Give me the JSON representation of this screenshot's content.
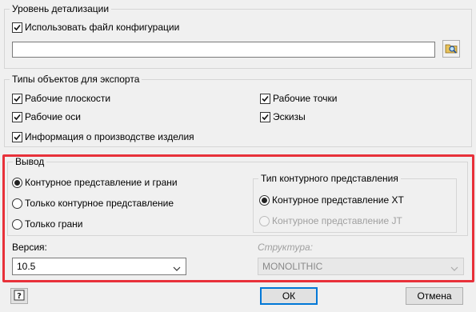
{
  "detail": {
    "legend": "Уровень детализации",
    "use_config_label": "Использовать файл конфигурации",
    "use_config_checked": true,
    "config_path_value": ""
  },
  "export_types": {
    "legend": "Типы объектов для экспорта",
    "items": [
      {
        "label": "Рабочие плоскости",
        "checked": true
      },
      {
        "label": "Рабочие точки",
        "checked": true
      },
      {
        "label": "Рабочие оси",
        "checked": true
      },
      {
        "label": "Эскизы",
        "checked": true
      },
      {
        "label": "Информация о производстве изделия",
        "checked": true
      }
    ]
  },
  "output": {
    "legend": "Вывод",
    "options": [
      {
        "label": "Контурное представление и грани",
        "selected": true
      },
      {
        "label": "Только контурное представление",
        "selected": false
      },
      {
        "label": "Только грани",
        "selected": false
      }
    ],
    "contour_type": {
      "legend": "Тип контурного представления",
      "options": [
        {
          "label": "Контурное представление XT",
          "selected": true,
          "enabled": true
        },
        {
          "label": "Контурное представление JT",
          "selected": false,
          "enabled": false
        }
      ]
    },
    "version_label": "Версия:",
    "version_value": "10.5",
    "structure_label": "Структура:",
    "structure_value": "MONOLITHIC"
  },
  "buttons": {
    "help_icon": "help-icon",
    "ok": "ОК",
    "cancel": "Отмена"
  },
  "colors": {
    "highlight": "#e8313a",
    "ok_border": "#0078d7"
  }
}
